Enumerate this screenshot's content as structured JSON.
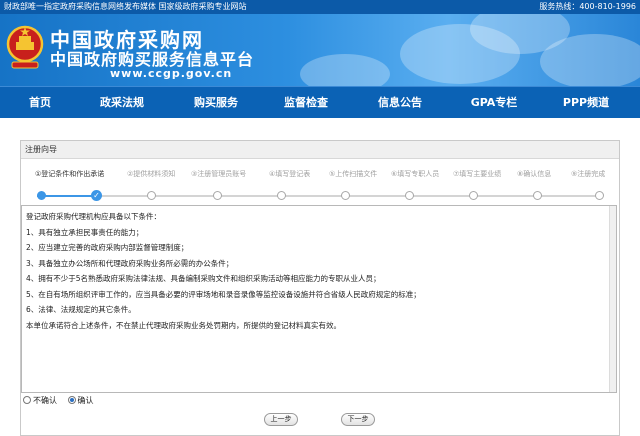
{
  "topbar": {
    "tagline": "财政部唯一指定政府采购信息网络发布媒体  国家级政府采购专业网站",
    "hotline": "服务热线：400-810-1996"
  },
  "header": {
    "title_cn": "中国政府采购网",
    "subtitle_cn": "中国政府购买服务信息平台",
    "url": "www.ccgp.gov.cn"
  },
  "nav": [
    {
      "label": "首页"
    },
    {
      "label": "政采法规"
    },
    {
      "label": "购买服务"
    },
    {
      "label": "监督检查"
    },
    {
      "label": "信息公告"
    },
    {
      "label": "GPA专栏"
    },
    {
      "label": "PPP频道"
    }
  ],
  "wizard": {
    "title": "注册向导",
    "steps": [
      {
        "label": "①登记条件和作出承诺"
      },
      {
        "label": "②提供材料须知"
      },
      {
        "label": "③注册管理员账号"
      },
      {
        "label": "④填写登记表"
      },
      {
        "label": "⑤上传扫描文件"
      },
      {
        "label": "⑥填写专职人员"
      },
      {
        "label": "⑦填写主要业绩"
      },
      {
        "label": "⑧确认信息"
      },
      {
        "label": "⑨注册完成"
      }
    ],
    "conditions": [
      "登记政府采购代理机构应具备以下条件：",
      "1、具有独立承担民事责任的能力；",
      "2、应当建立完善的政府采购内部监督管理制度；",
      "3、具备独立办公场所和代理政府采购业务所必需的办公条件；",
      "4、拥有不少于5名熟悉政府采购法律法规、具备编制采购文件和组织采购活动等相应能力的专职从业人员；",
      "5、在自有场所组织评审工作的，应当具备必要的评审场地和录音录像等监控设备设施并符合省级人民政府规定的标准；",
      "6、法律、法规规定的其它条件。",
      "本单位承诺符合上述条件，不在禁止代理政府采购业务处罚期内，所提供的登记材料真实有效。"
    ],
    "radio_disagree": "不确认",
    "radio_agree": "确认",
    "agree_selected": true,
    "prev_button": "上一步",
    "next_button": "下一步"
  },
  "colors": {
    "nav_bg": "#0b62b5",
    "accent": "#3c96e6",
    "emblem_red": "#c8201c",
    "emblem_gold": "#f5c431"
  }
}
